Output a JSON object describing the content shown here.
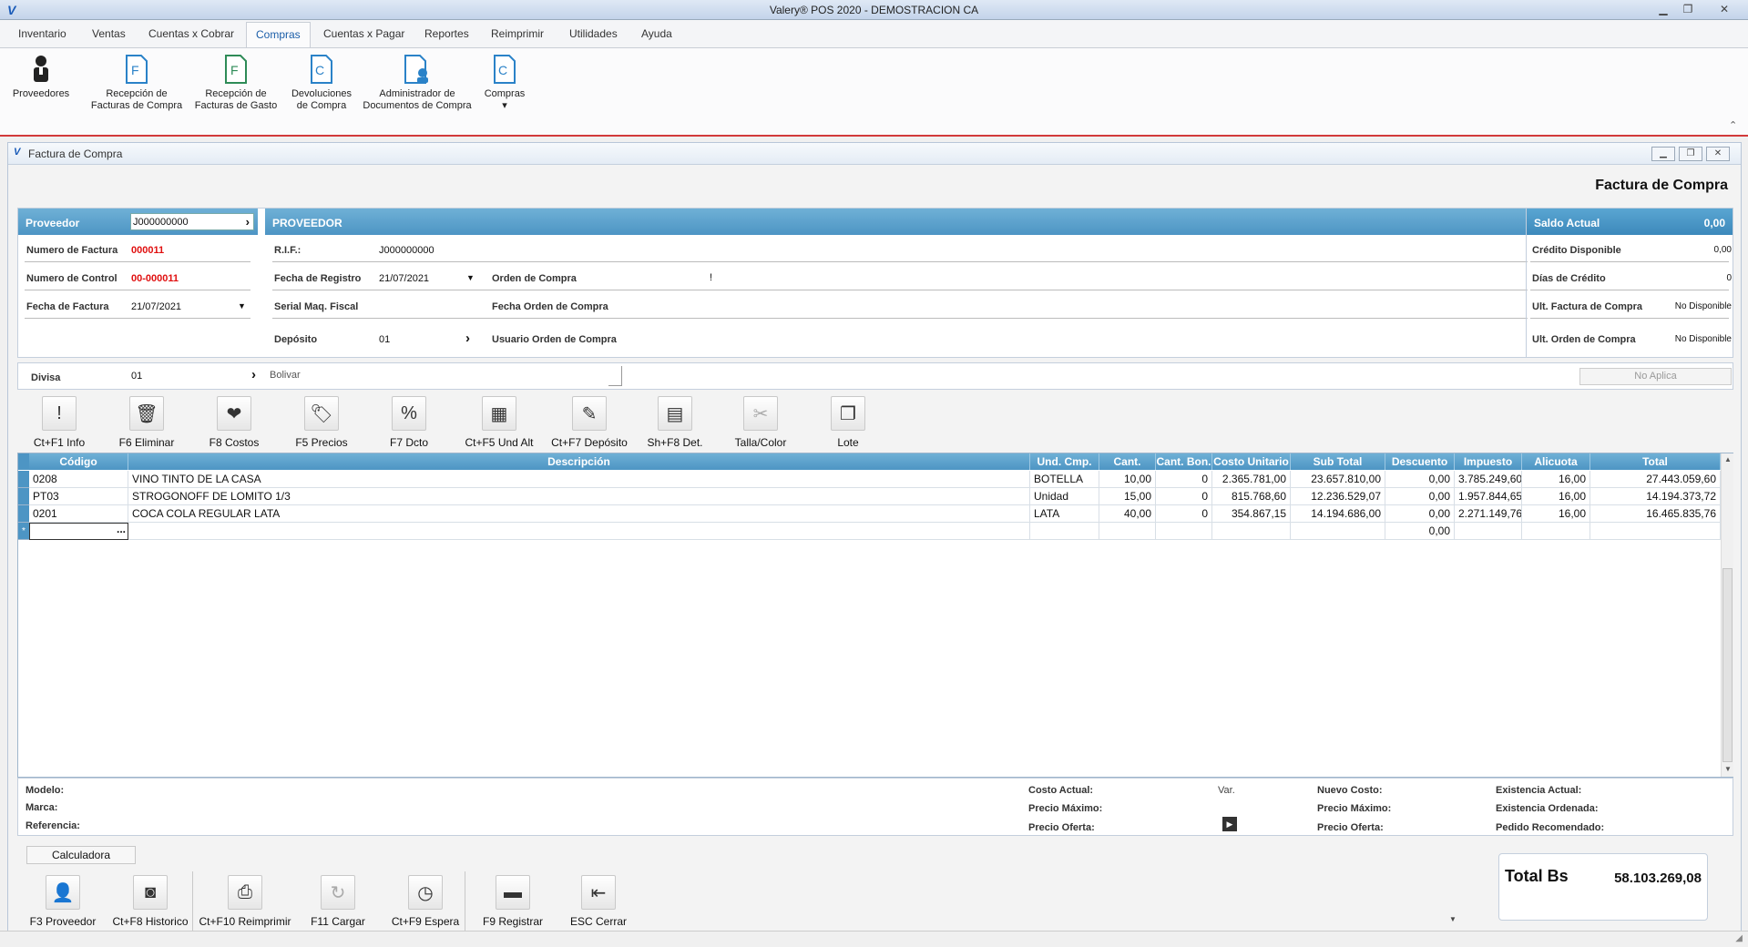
{
  "window": {
    "title": "Valery® POS 2020 - DEMOSTRACION CA"
  },
  "menu": [
    {
      "label": "Inventario"
    },
    {
      "label": "Ventas"
    },
    {
      "label": "Cuentas x Cobrar"
    },
    {
      "label": "Compras"
    },
    {
      "label": "Cuentas x Pagar"
    },
    {
      "label": "Reportes"
    },
    {
      "label": "Reimprimir"
    },
    {
      "label": "Utilidades"
    },
    {
      "label": "Ayuda"
    }
  ],
  "ribbon": [
    {
      "l1": "Proveedores",
      "l2": ""
    },
    {
      "l1": "Recepción de",
      "l2": "Facturas de Compra"
    },
    {
      "l1": "Recepción de",
      "l2": "Facturas de Gasto"
    },
    {
      "l1": "Devoluciones",
      "l2": "de Compra"
    },
    {
      "l1": "Administrador de",
      "l2": "Documentos de Compra"
    },
    {
      "l1": "Compras",
      "l2": "▾"
    }
  ],
  "child": {
    "title": "Factura de Compra",
    "heading": "Factura de Compra"
  },
  "proveedor": {
    "label": "Proveedor",
    "code": "J000000000",
    "num_factura_label": "Numero de Factura",
    "num_factura": "000011",
    "num_control_label": "Numero de Control",
    "num_control": "00-000011",
    "fecha_factura_label": "Fecha de Factura",
    "fecha_factura": "21/07/2021"
  },
  "prov_detail": {
    "head": "PROVEEDOR",
    "rif_label": "R.I.F.:",
    "rif": "J000000000",
    "fecha_registro_label": "Fecha de Registro",
    "fecha_registro": "21/07/2021",
    "serial_label": "Serial Maq. Fiscal",
    "deposito_label": "Depósito",
    "deposito": "01",
    "orden_label": "Orden de Compra",
    "fecha_orden_label": "Fecha Orden de Compra",
    "usuario_orden_label": "Usuario Orden de Compra"
  },
  "saldo": {
    "head": "Saldo Actual",
    "head_val": "0,00",
    "credito_label": "Crédito Disponible",
    "credito": "0,00",
    "dias_label": "Días de Crédito",
    "dias": "0",
    "ult_fact_label": "Ult. Factura de Compra",
    "ult_fact": "No Disponible",
    "ult_orden_label": "Ult. Orden de Compra",
    "ult_orden": "No Disponible"
  },
  "divisa": {
    "label": "Divisa",
    "code": "01",
    "name": "Bolivar",
    "no_aplica": "No Aplica"
  },
  "toolbar": [
    {
      "label": "Ct+F1 Info",
      "icon": "!"
    },
    {
      "label": "F6 Eliminar",
      "icon": "🗑"
    },
    {
      "label": "F8 Costos",
      "icon": "❤"
    },
    {
      "label": "F5 Precios",
      "icon": "🏷"
    },
    {
      "label": "F7 Dcto",
      "icon": "%"
    },
    {
      "label": "Ct+F5 Und Alt",
      "icon": "▦"
    },
    {
      "label": "Ct+F7 Depósito",
      "icon": "✎"
    },
    {
      "label": "Sh+F8 Det.",
      "icon": "▤"
    },
    {
      "label": "Talla/Color",
      "icon": "✂"
    },
    {
      "label": "Lote",
      "icon": "❐"
    }
  ],
  "grid": {
    "headers": [
      "Código",
      "Descripción",
      "Und. Cmp.",
      "Cant.",
      "Cant. Bon.",
      "Costo Unitario",
      "Sub Total",
      "Descuento",
      "Impuesto",
      "Alicuota",
      "Total"
    ],
    "rows": [
      [
        "0208",
        "VINO TINTO DE LA CASA",
        "BOTELLA",
        "10,00",
        "0",
        "2.365.781,00",
        "23.657.810,00",
        "0,00",
        "3.785.249,60",
        "16,00",
        "27.443.059,60"
      ],
      [
        "PT03",
        "STROGONOFF DE LOMITO 1/3",
        "Unidad",
        "15,00",
        "0",
        "815.768,60",
        "12.236.529,07",
        "0,00",
        "1.957.844,65",
        "16,00",
        "14.194.373,72"
      ],
      [
        "0201",
        "COCA COLA REGULAR LATA",
        "LATA",
        "40,00",
        "0",
        "354.867,15",
        "14.194.686,00",
        "0,00",
        "2.271.149,76",
        "16,00",
        "16.465.835,76"
      ]
    ],
    "new_row_descuento": "0,00",
    "new_row_ellipsis": "...",
    "new_row_marker": "*"
  },
  "info": {
    "modelo": "Modelo:",
    "marca": "Marca:",
    "referencia": "Referencia:",
    "costo_actual": "Costo Actual:",
    "var": "Var.",
    "precio_max": "Precio Máximo:",
    "precio_oferta": "Precio Oferta:",
    "nuevo_costo": "Nuevo Costo:",
    "precio_max2": "Precio Máximo:",
    "precio_oferta2": "Precio Oferta:",
    "existencia": "Existencia Actual:",
    "ordenada": "Existencia Ordenada:",
    "pedido": "Pedido Recomendado:"
  },
  "calc": "Calculadora",
  "bottom": [
    {
      "label": "F3 Proveedor",
      "icon": "👤"
    },
    {
      "label": "Ct+F8 Historico",
      "icon": "◙"
    },
    {
      "label": "Ct+F10 Reimprimir",
      "icon": "⎙"
    },
    {
      "label": "F11 Cargar",
      "icon": "↻"
    },
    {
      "label": "Ct+F9 Espera",
      "icon": "◷"
    },
    {
      "label": "F9 Registrar",
      "icon": "▬"
    },
    {
      "label": "ESC Cerrar",
      "icon": "⇤"
    }
  ],
  "total": {
    "label": "Total Bs",
    "value": "58.103.269,08"
  }
}
